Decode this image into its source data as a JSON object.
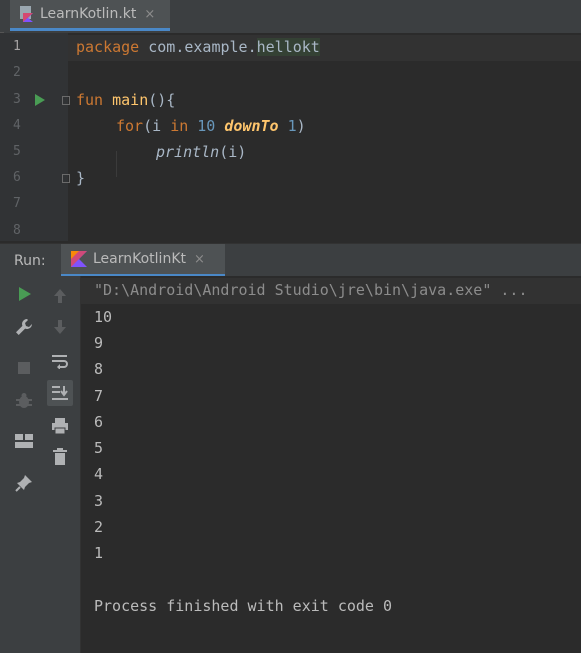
{
  "editor_tab": {
    "label": "LearnKotlin.kt",
    "close": "×"
  },
  "editor": {
    "line_numbers": [
      "1",
      "2",
      "3",
      "4",
      "5",
      "6",
      "7",
      "8"
    ],
    "line1": {
      "kw": "package",
      "pkg_a": "com.example.",
      "pkg_b": "hellokt"
    },
    "line3": {
      "kw": "fun",
      "name": "main",
      "rest": "(){"
    },
    "line4": {
      "kw_for": "for",
      "open": "(i ",
      "kw_in": "in",
      "n1": "10",
      "down": "downTo",
      "n2": "1",
      "close": ")"
    },
    "line5": {
      "fn": "println",
      "args": "(i)"
    },
    "line6": {
      "brace": "}"
    }
  },
  "run_panel": {
    "title": "Run:",
    "tab_label": "LearnKotlinKt",
    "tab_close": "×",
    "command": "\"D:\\Android\\Android Studio\\jre\\bin\\java.exe\" ...",
    "output": [
      "10",
      "9",
      "8",
      "7",
      "6",
      "5",
      "4",
      "3",
      "2",
      "1"
    ],
    "finished": "Process finished with exit code 0"
  },
  "colors": {
    "accent": "#4a88c7",
    "run_green": "#499c54",
    "keyword": "#cc7832",
    "number": "#6897bb"
  }
}
